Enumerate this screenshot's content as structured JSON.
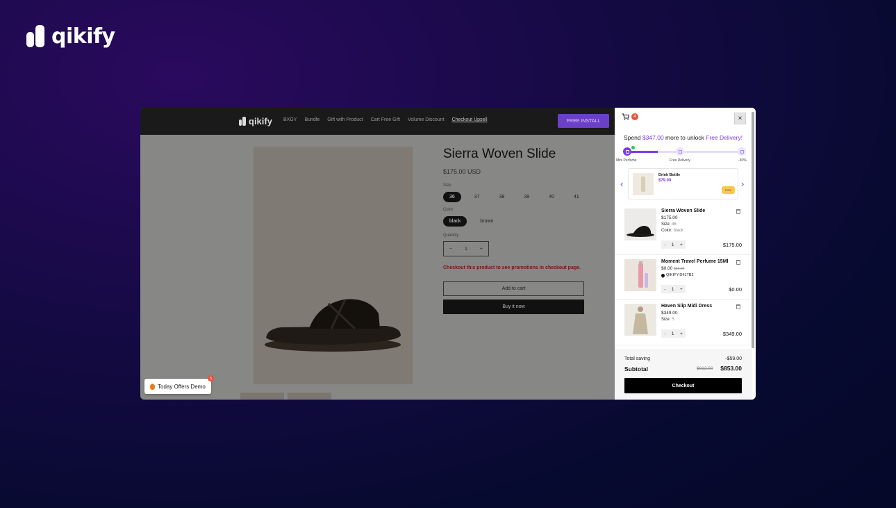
{
  "brand": {
    "name": "qikify"
  },
  "store": {
    "logo": "qikify",
    "nav": [
      "BXGY",
      "Bundle",
      "Gift with Product",
      "Cart Free Gift",
      "Volume Discount",
      "Checkout Upsell"
    ],
    "cta": "FREE INSTALL",
    "product": {
      "title": "Sierra Woven Slide",
      "price": "$175.00 USD",
      "size_label": "Size",
      "sizes": [
        "36",
        "37",
        "38",
        "39",
        "40",
        "41"
      ],
      "selected_size": "36",
      "color_label": "Color",
      "colors": [
        "black",
        "brown"
      ],
      "selected_color": "black",
      "quantity_label": "Quantity",
      "quantity": "1",
      "promo_note": "Checkout this product to see promotions in checkout page.",
      "add_to_cart": "Add to cart",
      "buy_now": "Buy it now"
    },
    "offers_widget": {
      "label": "Today Offers Demo",
      "badge": "5"
    }
  },
  "cart": {
    "count": "4",
    "close": "×",
    "progress": {
      "prefix": "Spend ",
      "amount": "$347.00",
      "middle": " more to unlock ",
      "reward": "Free Delivery!",
      "fraction": 0.27,
      "milestones": [
        "Mini Perfume",
        "Free Delivery",
        "-30%"
      ]
    },
    "gift": {
      "name": "Drink Bottle",
      "price": "$79.00",
      "action": "PICK"
    },
    "items": [
      {
        "name": "Sierra Woven Slide",
        "price": "$175.00",
        "old_price": "",
        "size_label": "Size:",
        "size": "36",
        "color_label": "Color:",
        "color": "black",
        "qty": "1",
        "total": "$175.00"
      },
      {
        "name": "Moment Travel Perfume 15Ml",
        "price": "$0.00",
        "old_price": "$59.00",
        "code": "QIKIFY-D41TB2",
        "qty": "1",
        "total": "$0.00"
      },
      {
        "name": "Haven Slip Midi Dress",
        "price": "$349.00",
        "size_label": "Size:",
        "size": "S",
        "qty": "1",
        "total": "$349.00"
      }
    ],
    "total_saving_label": "Total saving",
    "total_saving": "-$59.00",
    "subtotal_label": "Subtotal",
    "subtotal_old": "$912.00",
    "subtotal": "$853.00",
    "checkout": "Checkout"
  }
}
